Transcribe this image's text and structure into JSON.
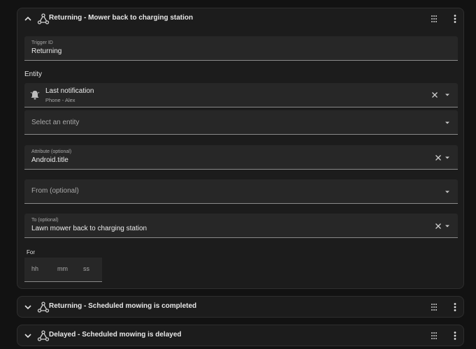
{
  "cards": [
    {
      "title": "Returning - Mower back to charging station",
      "expanded": true
    },
    {
      "title": "Returning - Scheduled mowing is completed",
      "expanded": false
    },
    {
      "title": "Delayed - Scheduled mowing is delayed",
      "expanded": false
    }
  ],
  "trigger_id": {
    "label": "Trigger ID",
    "value": "Returning"
  },
  "entity_section": {
    "label": "Entity"
  },
  "entity_selected": {
    "name": "Last notification",
    "device": "Phone - Alex",
    "icon": "bell-icon"
  },
  "entity_add": {
    "placeholder": "Select an entity"
  },
  "attribute": {
    "label": "Attribute (optional)",
    "value": "Android.title"
  },
  "from": {
    "placeholder": "From (optional)"
  },
  "to": {
    "label": "To (optional)",
    "value": "Lawn mower back to charging station"
  },
  "for": {
    "label": "For",
    "hh": "hh",
    "mm": "mm",
    "ss": "ss"
  },
  "colors": {
    "background": "#121212",
    "card": "#1c1c1c",
    "field": "#272727",
    "text": "#e1e1e1",
    "muted": "#a9a9a9"
  }
}
